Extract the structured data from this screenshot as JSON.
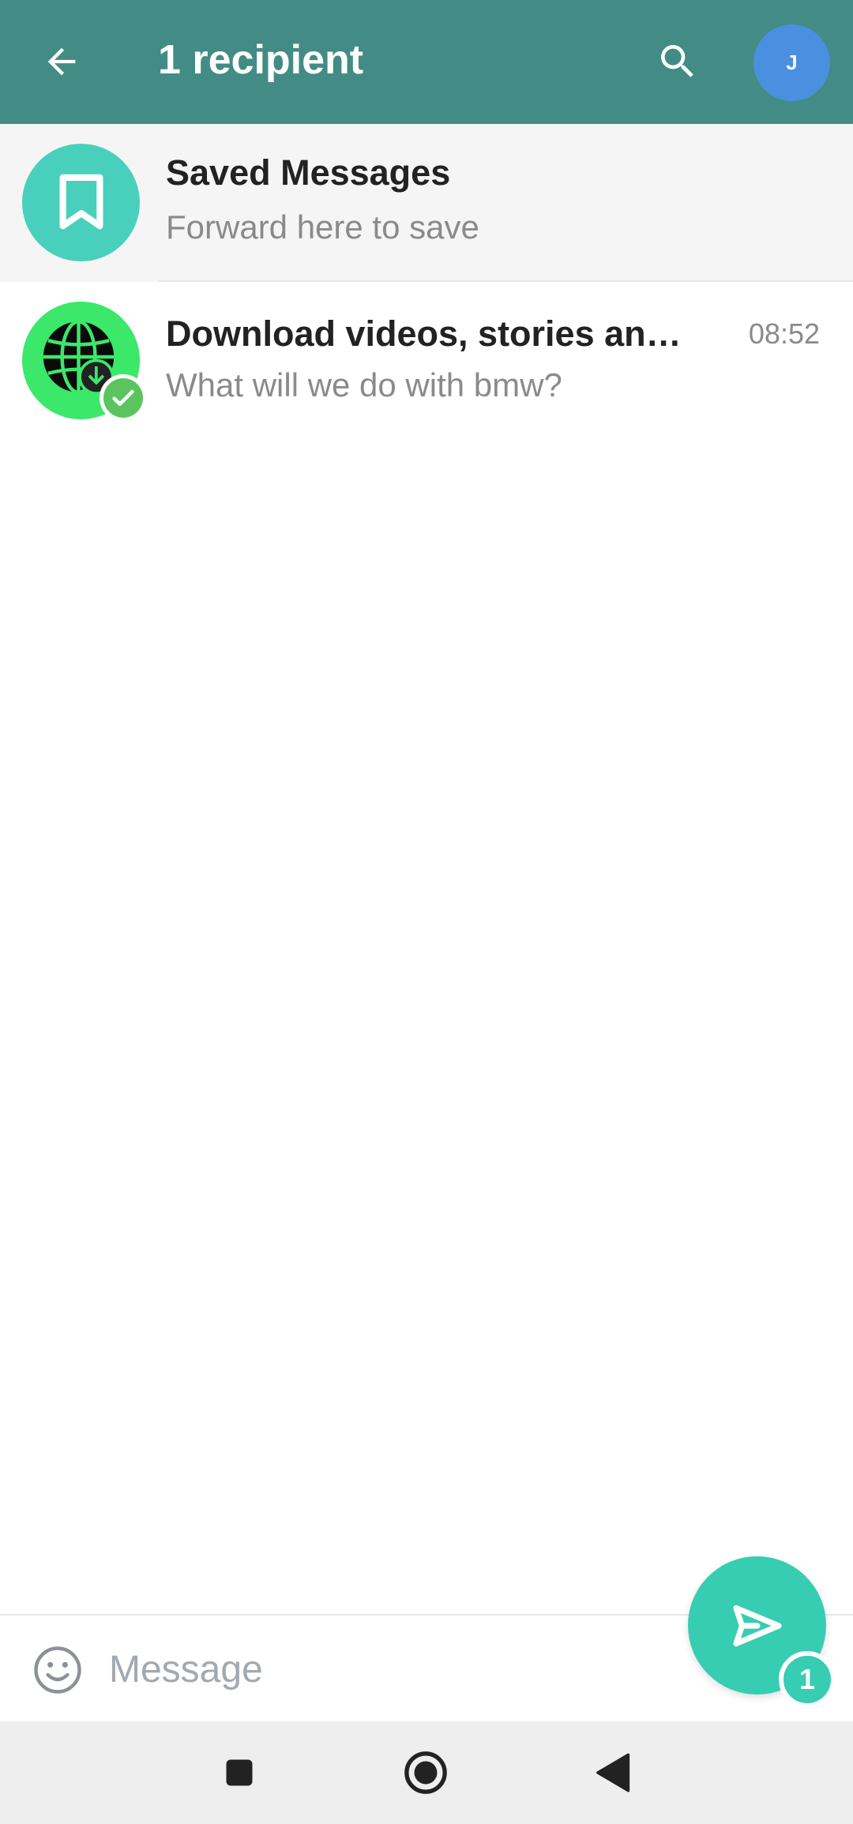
{
  "header": {
    "title": "1 recipient",
    "avatar_letter": "J",
    "icons": {
      "back": "arrow-left-icon",
      "search": "search-icon"
    }
  },
  "colors": {
    "header_bg": "#428c85",
    "accent": "#36cdb2",
    "saved_avatar": "#49d0bd",
    "account_avatar": "#4a8fe0",
    "verified_badge": "#5cc45f"
  },
  "chats": [
    {
      "name": "Saved Messages",
      "subtitle": "Forward here to save",
      "time": "",
      "icon": "bookmark-icon",
      "selected": false
    },
    {
      "name": "Download videos, stories and r...",
      "subtitle": "What will we do with bmw?",
      "time": "08:52",
      "icon": "globe-download-icon",
      "selected": true
    }
  ],
  "composer": {
    "placeholder": "Message",
    "emoji_icon": "smile-icon",
    "send_icon": "send-icon",
    "selected_count": "1"
  },
  "navbar": {
    "icons": [
      "recents-square-icon",
      "home-circle-icon",
      "back-triangle-icon"
    ]
  }
}
